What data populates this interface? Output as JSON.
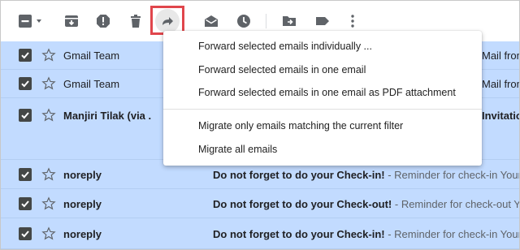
{
  "toolbar": {
    "buttons": [
      {
        "icon": "select-all-checkbox-icon"
      },
      {
        "icon": "archive-icon"
      },
      {
        "icon": "report-spam-icon"
      },
      {
        "icon": "delete-icon"
      },
      {
        "icon": "forward-icon"
      },
      {
        "icon": "mark-as-read-icon"
      },
      {
        "icon": "snooze-icon"
      },
      {
        "icon": "move-to-icon"
      },
      {
        "icon": "label-icon"
      },
      {
        "icon": "more-options-icon"
      }
    ],
    "highlight_color": "#e0464c"
  },
  "emails": [
    {
      "sender": "Gmail Team",
      "unread": false,
      "subject": "",
      "snippet": "",
      "edge_text": "Mail from"
    },
    {
      "sender": "Gmail Team",
      "unread": false,
      "subject": "",
      "snippet": "",
      "edge_text": "Mail from"
    },
    {
      "sender": "Manjiri Tilak (via .",
      "unread": true,
      "subject": "",
      "snippet": "",
      "edge_text": "Invitatio"
    },
    {
      "sender": "noreply",
      "unread": true,
      "subject": "Do not forget to do your Check-in!",
      "snippet": " - Reminder for check-in Your s",
      "edge_text": ""
    },
    {
      "sender": "noreply",
      "unread": true,
      "subject": "Do not forget to do your Check-out!",
      "snippet": " - Reminder for check-out Your s",
      "edge_text": ""
    },
    {
      "sender": "noreply",
      "unread": true,
      "subject": "Do not forget to do your Check-in!",
      "snippet": " - Reminder for check-in Your s",
      "edge_text": ""
    }
  ],
  "forward_menu": {
    "items": [
      {
        "label": "Forward selected emails individually ..."
      },
      {
        "label": "Forward selected emails in one email"
      },
      {
        "label": "Forward selected emails in one email as PDF attachment"
      },
      {
        "label": "Migrate only emails matching the current filter"
      },
      {
        "label": "Migrate all emails"
      }
    ]
  },
  "colors": {
    "selected_row": "#c2dbff",
    "checkbox": "#444746"
  }
}
